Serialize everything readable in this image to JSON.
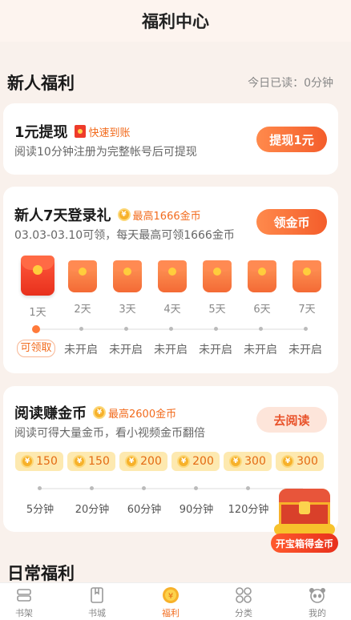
{
  "header": {
    "title": "福利中心"
  },
  "newbie": {
    "title": "新人福利",
    "today_read": "今日已读：0分钟"
  },
  "withdraw": {
    "title": "1元提现",
    "tag": "快速到账",
    "desc": "阅读10分钟注册为完整帐号后可提现",
    "button": "提现1元"
  },
  "login": {
    "title": "新人7天登录礼",
    "tag": "最高1666金币",
    "desc": "03.03-03.10可领，每天最高可领1666金币",
    "button": "领金币",
    "days": [
      "1天",
      "2天",
      "3天",
      "4天",
      "5天",
      "6天",
      "7天"
    ],
    "statuses": [
      "可领取",
      "未开启",
      "未开启",
      "未开启",
      "未开启",
      "未开启",
      "未开启"
    ]
  },
  "read": {
    "title": "阅读赚金币",
    "tag": "最高2600金币",
    "desc": "阅读可得大量金币，看小视频金币翻倍",
    "button": "去阅读",
    "rewards": [
      "150",
      "150",
      "200",
      "200",
      "300",
      "300"
    ],
    "durations": [
      "5分钟",
      "20分钟",
      "60分钟",
      "90分钟",
      "120分钟"
    ]
  },
  "chest": {
    "label": "开宝箱得金币"
  },
  "daily": {
    "title": "日常福利"
  },
  "tabs": [
    {
      "label": "书架",
      "icon": "bookshelf-icon"
    },
    {
      "label": "书城",
      "icon": "bookstore-icon"
    },
    {
      "label": "福利",
      "icon": "welfare-coin-icon"
    },
    {
      "label": "分类",
      "icon": "category-icon"
    },
    {
      "label": "我的",
      "icon": "profile-panda-icon"
    }
  ],
  "colors": {
    "accent": "#f26b1d",
    "button": "#f45d2b",
    "bg": "#f9f1ec"
  }
}
